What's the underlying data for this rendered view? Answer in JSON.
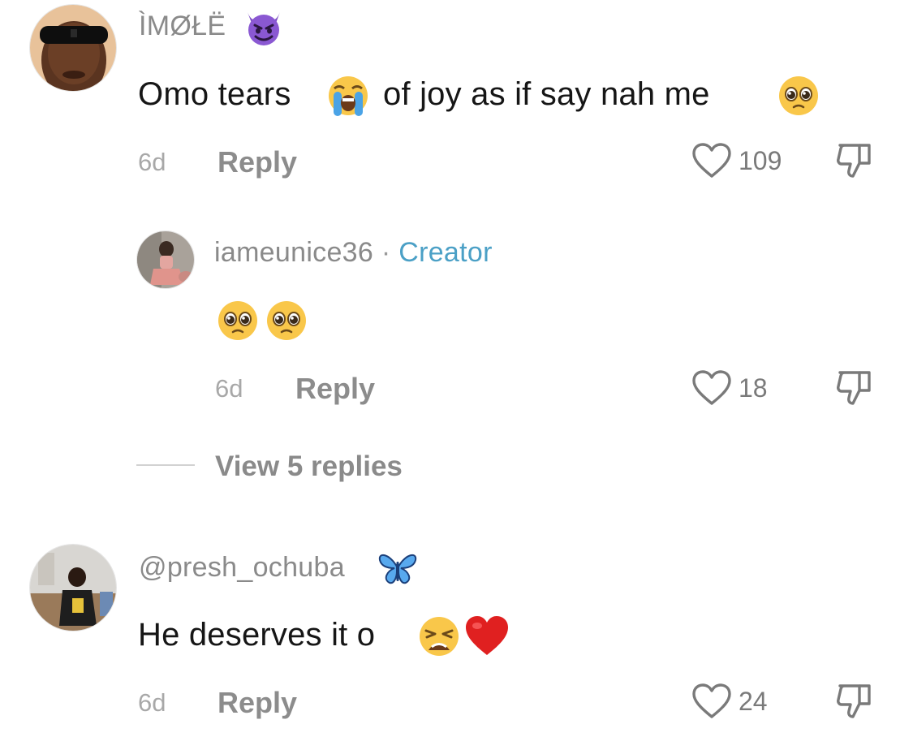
{
  "comments": [
    {
      "username": "ÌMØŁË",
      "username_emoji": "smiling-devil-emoji",
      "text_part1": "Omo tears",
      "text_part2": "of joy as if say nah me",
      "emojis": [
        "loudly-crying-face-emoji",
        "pleading-face-emoji"
      ],
      "time": "6d",
      "reply_label": "Reply",
      "likes": "109"
    },
    {
      "username": "iameunice36",
      "separator": "·",
      "badge": "Creator",
      "emojis": [
        "pleading-face-emoji",
        "pleading-face-emoji"
      ],
      "time": "6d",
      "reply_label": "Reply",
      "likes": "18"
    },
    {
      "username": "@presh_ochuba",
      "username_emoji": "butterfly-emoji",
      "text": "He deserves it o",
      "emojis": [
        "weary-face-emoji",
        "red-heart-emoji"
      ],
      "time": "6d",
      "reply_label": "Reply",
      "likes": "24"
    }
  ],
  "view_replies": "View 5 replies",
  "colors": {
    "creator": "#4ba0c6",
    "text": "#161616",
    "muted": "#8a8a8a"
  }
}
